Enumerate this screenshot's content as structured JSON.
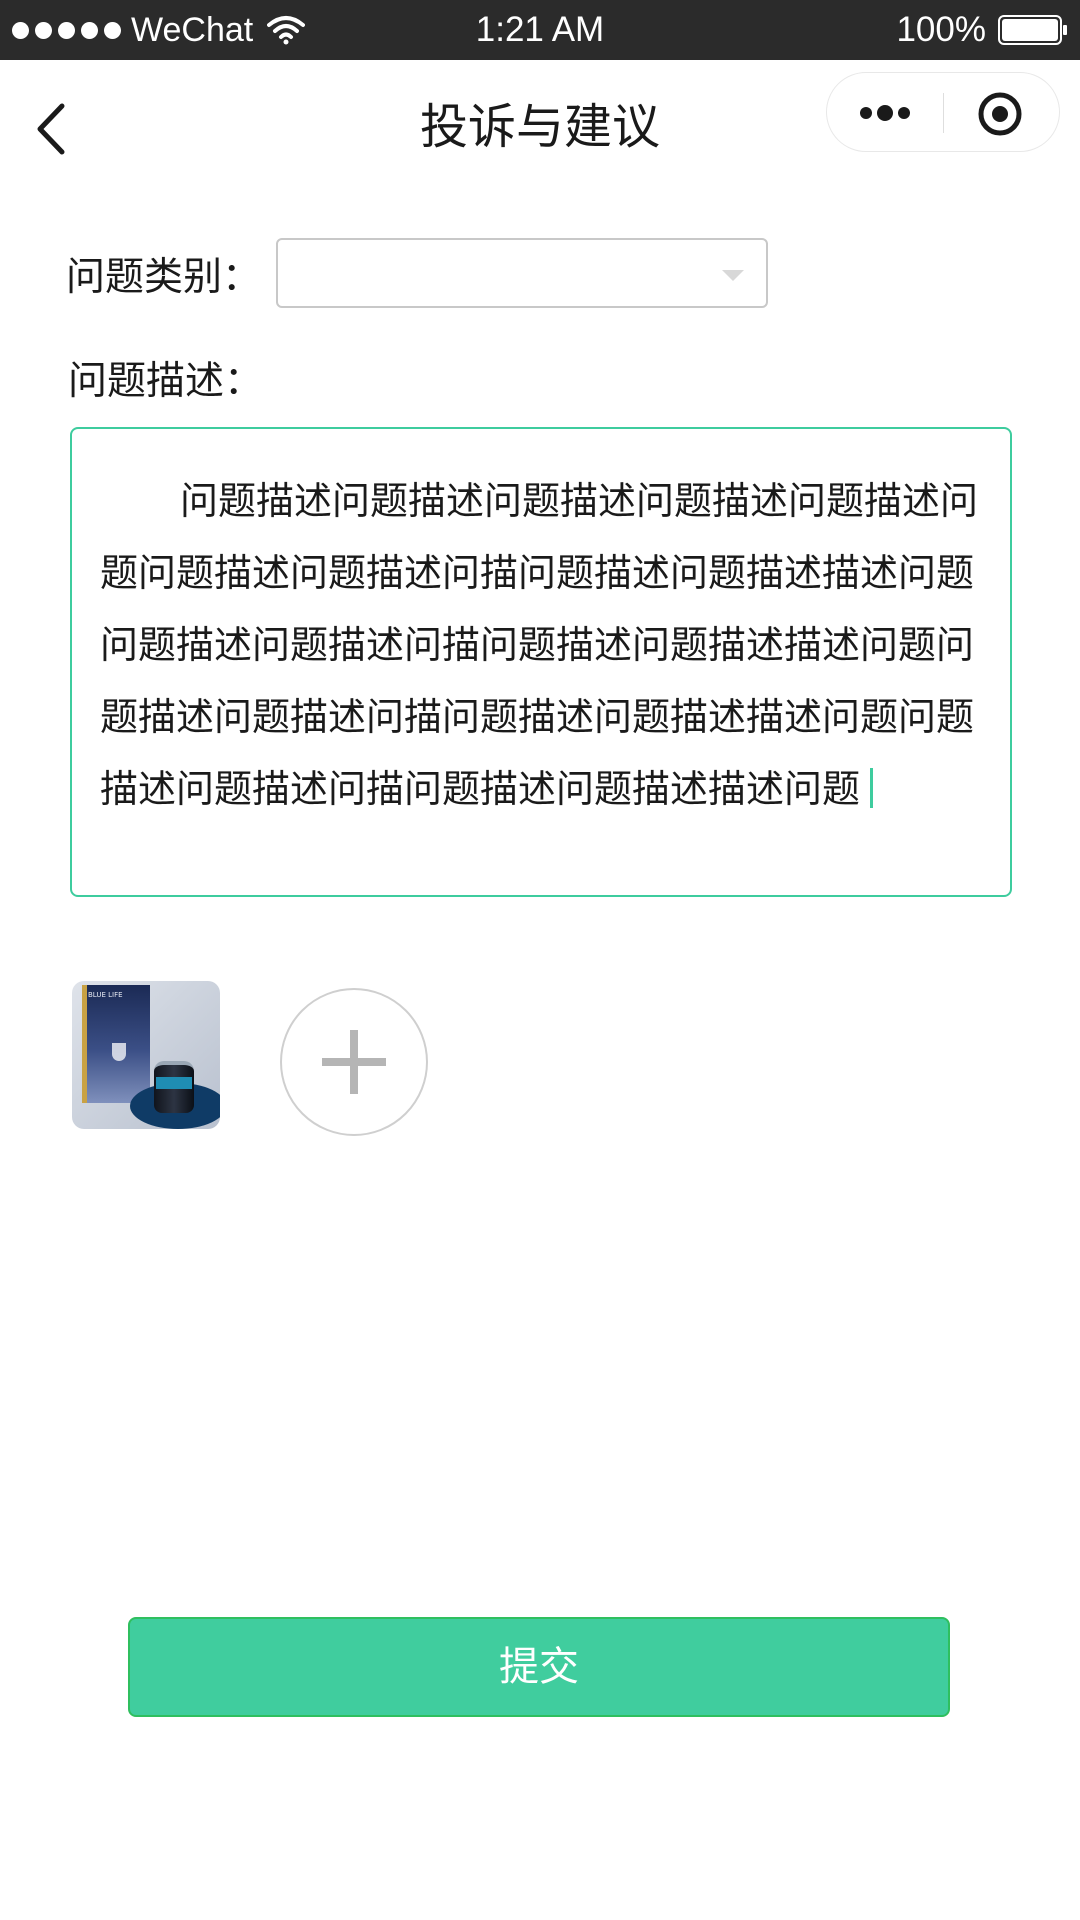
{
  "status_bar": {
    "carrier": "WeChat",
    "time": "1:21 AM",
    "battery": "100%",
    "icons": [
      "signal-dots-icon",
      "wifi-icon",
      "battery-icon"
    ]
  },
  "nav": {
    "title": "投诉与建议",
    "icons": [
      "back-icon",
      "more-icon",
      "target-icon"
    ]
  },
  "form": {
    "category_label": "问题类别：",
    "category_value": "",
    "description_label": "问题描述：",
    "description_value": "问题描述问题描述问题描述问题描述问题描述问题问题描述问题描述问描问题描述问题描述描述问题问题描述问题描述问描问题描述问题描述描述问题问题描述问题描述问描问题描述问题描述描述问题问题描述问题描述问描问题描述问题描述描述问题"
  },
  "images": {
    "uploaded_count": 1,
    "thumbnail_text": "BLUE LIFE",
    "add_icon": "plus-icon"
  },
  "submit": {
    "label": "提交"
  },
  "colors": {
    "accent": "#40cd9e",
    "accent_border": "#3ecc9e",
    "status_bar_bg": "#2b2b2b"
  }
}
